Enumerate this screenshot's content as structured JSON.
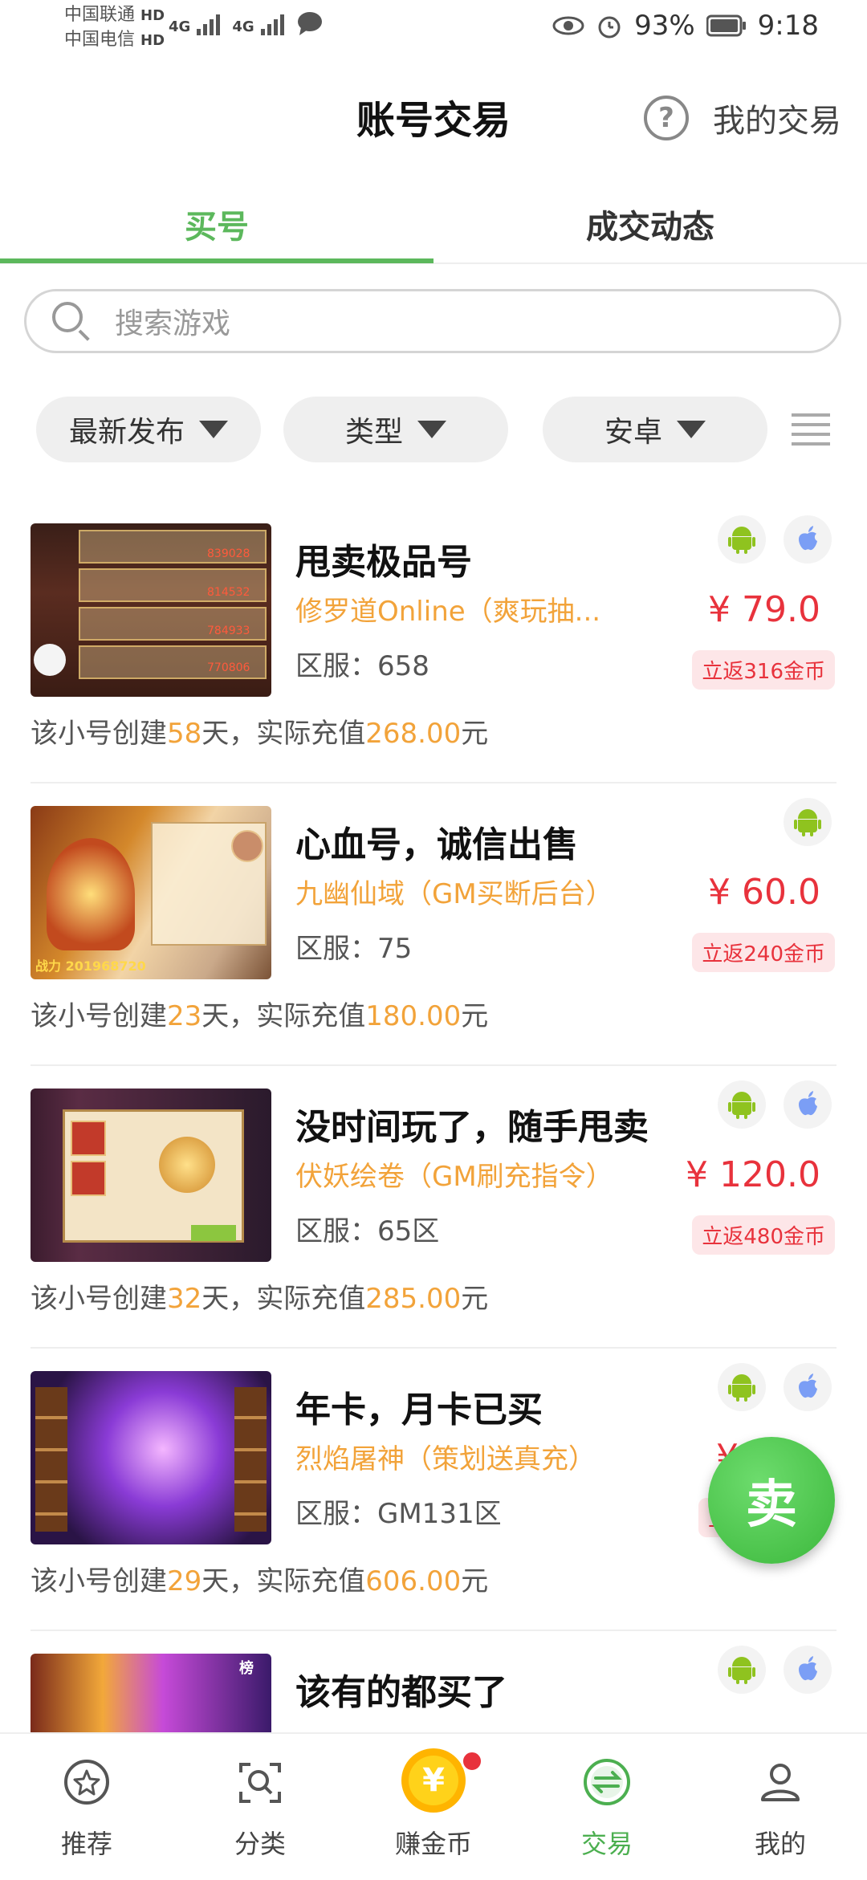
{
  "status_bar": {
    "carrier1": "中国联通",
    "carrier2": "中国电信",
    "hd": "HD",
    "net": "4G",
    "battery": "93%",
    "time": "9:18"
  },
  "header": {
    "title": "账号交易",
    "my_trades": "我的交易",
    "help_glyph": "?"
  },
  "tabs": [
    {
      "label": "买号",
      "active": true
    },
    {
      "label": "成交动态",
      "active": false
    }
  ],
  "search": {
    "placeholder": "搜索游戏"
  },
  "filters": [
    {
      "label": "最新发布"
    },
    {
      "label": "类型"
    },
    {
      "label": "安卓"
    }
  ],
  "listings": [
    {
      "title": "甩卖极品号",
      "game": "修罗道Online（爽玩抽...",
      "server": "区服：658",
      "price": "¥ 79.0",
      "rebate": "立返316金币",
      "platforms": [
        "android-icon",
        "apple-icon"
      ],
      "footer": {
        "p1": "该小号创建",
        "days": "58",
        "p2": "天，实际充值",
        "amount": "268.00",
        "p3": "元"
      }
    },
    {
      "title": "心血号，诚信出售",
      "game": "九幽仙域（GM买断后台）",
      "server": "区服：75",
      "price": "¥ 60.0",
      "rebate": "立返240金币",
      "platforms": [
        "android-icon"
      ],
      "footer": {
        "p1": "该小号创建",
        "days": "23",
        "p2": "天，实际充值",
        "amount": "180.00",
        "p3": "元"
      }
    },
    {
      "title": "没时间玩了，随手甩卖",
      "game": "伏妖绘卷（GM刷充指令）",
      "server": "区服：65区",
      "price": "¥ 120.0",
      "rebate": "立返480金币",
      "platforms": [
        "android-icon",
        "apple-icon"
      ],
      "footer": {
        "p1": "该小号创建",
        "days": "32",
        "p2": "天，实际充值",
        "amount": "285.00",
        "p3": "元"
      }
    },
    {
      "title": "年卡，月卡已买",
      "game": "烈焰屠神（策划送真充）",
      "server": "区服：GM131区",
      "price": "¥",
      "rebate": "立",
      "platforms": [
        "android-icon",
        "apple-icon"
      ],
      "footer": {
        "p1": "该小号创建",
        "days": "29",
        "p2": "天，实际充值",
        "amount": "606.00",
        "p3": "元"
      }
    },
    {
      "title": "该有的都买了",
      "platforms": [
        "android-icon",
        "apple-icon"
      ]
    }
  ],
  "thumb_texts": {
    "t1": [
      "839028",
      "814532",
      "784933",
      "770806"
    ],
    "t2_power": "战力 201968720",
    "t4_tag": "榜"
  },
  "fab": {
    "label": "卖"
  },
  "bottom_nav": [
    {
      "label": "推荐",
      "icon": "star-icon"
    },
    {
      "label": "分类",
      "icon": "category-search-icon"
    },
    {
      "label": "赚金币",
      "icon": "gold-coin-icon",
      "coin_glyph": "¥"
    },
    {
      "label": "交易",
      "icon": "exchange-icon",
      "active": true
    },
    {
      "label": "我的",
      "icon": "user-icon"
    }
  ],
  "colors": {
    "accent_green": "#5cb85c",
    "price_red": "#e8323c",
    "highlight_orange": "#f2a33a"
  }
}
